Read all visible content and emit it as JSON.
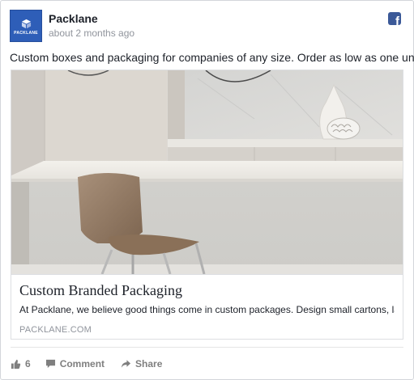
{
  "post": {
    "page_name": "Packlane",
    "timestamp": "about 2 months ago",
    "avatar_text": "PACKLANE",
    "avatar_color": "#2e5eb8",
    "network_icon": "facebook-icon",
    "network_color": "#3b5998",
    "network_glyph": "f",
    "message": "Custom boxes and packaging for companies of any size. Order as low as one unit."
  },
  "link": {
    "image_icon": "kitchen-photo",
    "title": "Custom Branded Packaging",
    "description": "At Packlane, we believe good things come in custom packages. Design small cartons, large pr...",
    "domain": "PACKLANE.COM"
  },
  "actions": {
    "like_icon": "thumbs-up-icon",
    "like_count": "6",
    "comment_icon": "comment-icon",
    "comment_label": "Comment",
    "share_icon": "share-arrow-icon",
    "share_label": "Share",
    "icon_color": "#7f7f7f"
  }
}
